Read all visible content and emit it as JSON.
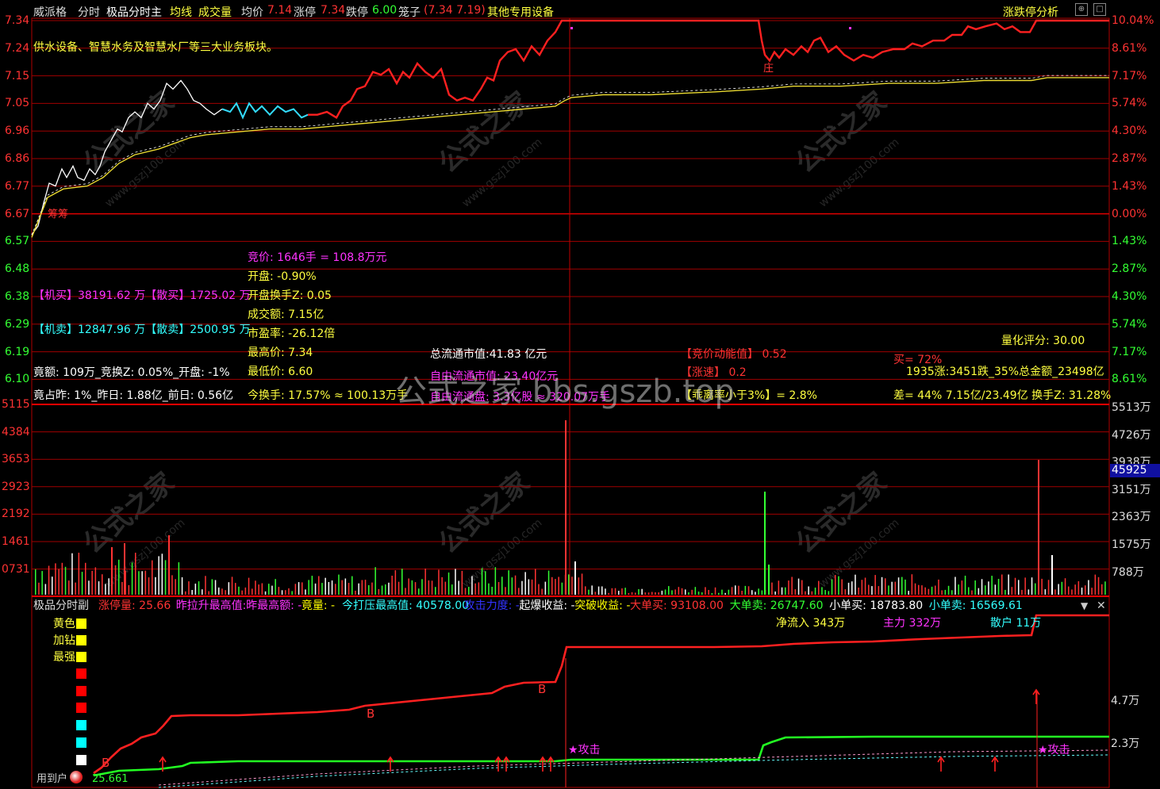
{
  "header": {
    "stock": "威派格",
    "mode": "分时",
    "indicator": "极品分时主",
    "ma_label": "均线",
    "vol_label": "成交量",
    "avg_label": "均价",
    "avg_value": "7.14",
    "up_label": "涨停",
    "up_value": "7.34",
    "down_label": "跌停",
    "down_value": "6.00",
    "cage_label": "笼子",
    "cage_value": "(7.34 7.19)",
    "industry": "其他专用设备",
    "right_button": "涨跌停分析"
  },
  "main": {
    "description": "供水设备、智慧水务及智慧水厂等三大业务板块。",
    "price_ticks": [
      "7.34",
      "7.24",
      "7.15",
      "7.05",
      "6.96",
      "6.86",
      "6.77",
      "6.67",
      "6.57",
      "6.48",
      "6.38",
      "6.29",
      "6.19",
      "6.10"
    ],
    "pct_ticks": [
      "10.04%",
      "8.61%",
      "7.17%",
      "5.74%",
      "4.30%",
      "2.87%",
      "1.43%",
      "0.00%",
      "1.43%",
      "2.87%",
      "4.30%",
      "5.74%",
      "7.17%",
      "8.61%"
    ],
    "mark_zhuang": "庄",
    "mark_choucou": "筹筹",
    "info": {
      "bid": "竞价: 1646手 = 108.8万元",
      "open": "开盘: -0.90%",
      "open_turnover": "开盘换手Z: 0.05",
      "amount": "成交额: 7.15亿",
      "pe": "市盈率: -26.12倍",
      "high": "最高价: 7.34",
      "low": "最低价: 6.60",
      "turnover": "今换手: 17.57%  ≈ 100.13万手",
      "total_mv": "总流通市值:41.83 亿元",
      "free_mv": "自由流通市值: 23.40亿元",
      "free_shares": "自由流通盘: 3.3亿股  ≈ 320.07万手",
      "bid_energy": "【竞价动能值】 0.52",
      "speed": "【涨速】 0.2",
      "deviation": "【乖离率小于3%】= 2.8%",
      "inst_buy": "【机买】38191.62 万【散买】1725.02 万",
      "inst_sell": "【机卖】12847.96 万【散卖】2500.95 万",
      "bid_amt": "竟额: 109万_竞换Z: 0.05%_开盘: -1%",
      "bid_ratio": "竟占昨: 1%_昨日: 1.88亿_前日: 0.56亿",
      "quant_score": "量化评分:  30.00",
      "buy_pct": "买= 72%",
      "market": "1935涨:3451跌_35%总金额_23498亿",
      "diff": "差= 44% 7.15亿/23.49亿  换手Z: 31.28%"
    }
  },
  "volume": {
    "left_ticks": [
      "5115",
      "4384",
      "3653",
      "2923",
      "2192",
      "1461",
      "0731"
    ],
    "right_ticks": [
      "5513万",
      "4726万",
      "3938万",
      "3151万",
      "2363万",
      "1575万",
      "788万"
    ],
    "current_badge": "45925"
  },
  "sub": {
    "title": "极品分时副",
    "fields": [
      {
        "label": "涨停量:",
        "value": "25.66",
        "color": "#ff3333"
      },
      {
        "label": "昨拉升最高值:",
        "value": "-",
        "color": "#ff33ff"
      },
      {
        "label": "昨最高额:",
        "value": "-",
        "color": "#ff33ff"
      },
      {
        "label": "竟量:",
        "value": "-",
        "color": "#ffff00"
      },
      {
        "label": "今打压最高值:",
        "value": "40578.00",
        "color": "#33ffff"
      },
      {
        "label": "攻击力度:",
        "value": "-",
        "color": "#3333ff"
      },
      {
        "label": "起爆收益:",
        "value": "-",
        "color": "#ffffff"
      },
      {
        "label": "突破收益:",
        "value": "-",
        "color": "#ffff00"
      },
      {
        "label": "大单买:",
        "value": "93108.00",
        "color": "#ff3333"
      },
      {
        "label": "大单卖:",
        "value": "26747.60",
        "color": "#33ff33"
      },
      {
        "label": "小单买:",
        "value": "18783.80",
        "color": "#ffffff"
      },
      {
        "label": "小单卖:",
        "value": "16569.61",
        "color": "#33ffff"
      }
    ],
    "net_inflow": "净流入 343万",
    "main_force": "主力 332万",
    "retail": "散户 11万",
    "legend": [
      "黄色",
      "加钻",
      "最强"
    ],
    "right_ticks": [
      "4.7万",
      "2.3万"
    ],
    "attack1": "★攻击",
    "attack2": "★攻击",
    "b_marks": [
      "B",
      "B",
      "B"
    ],
    "bottom_left": "用到户",
    "bottom_value": "25.661"
  },
  "colors": {
    "up": "#ff2020",
    "down": "#20ff20",
    "avg": "#ffff40",
    "grid": "#b00000",
    "cyan": "#33ffff",
    "magenta": "#ff33ff"
  }
}
